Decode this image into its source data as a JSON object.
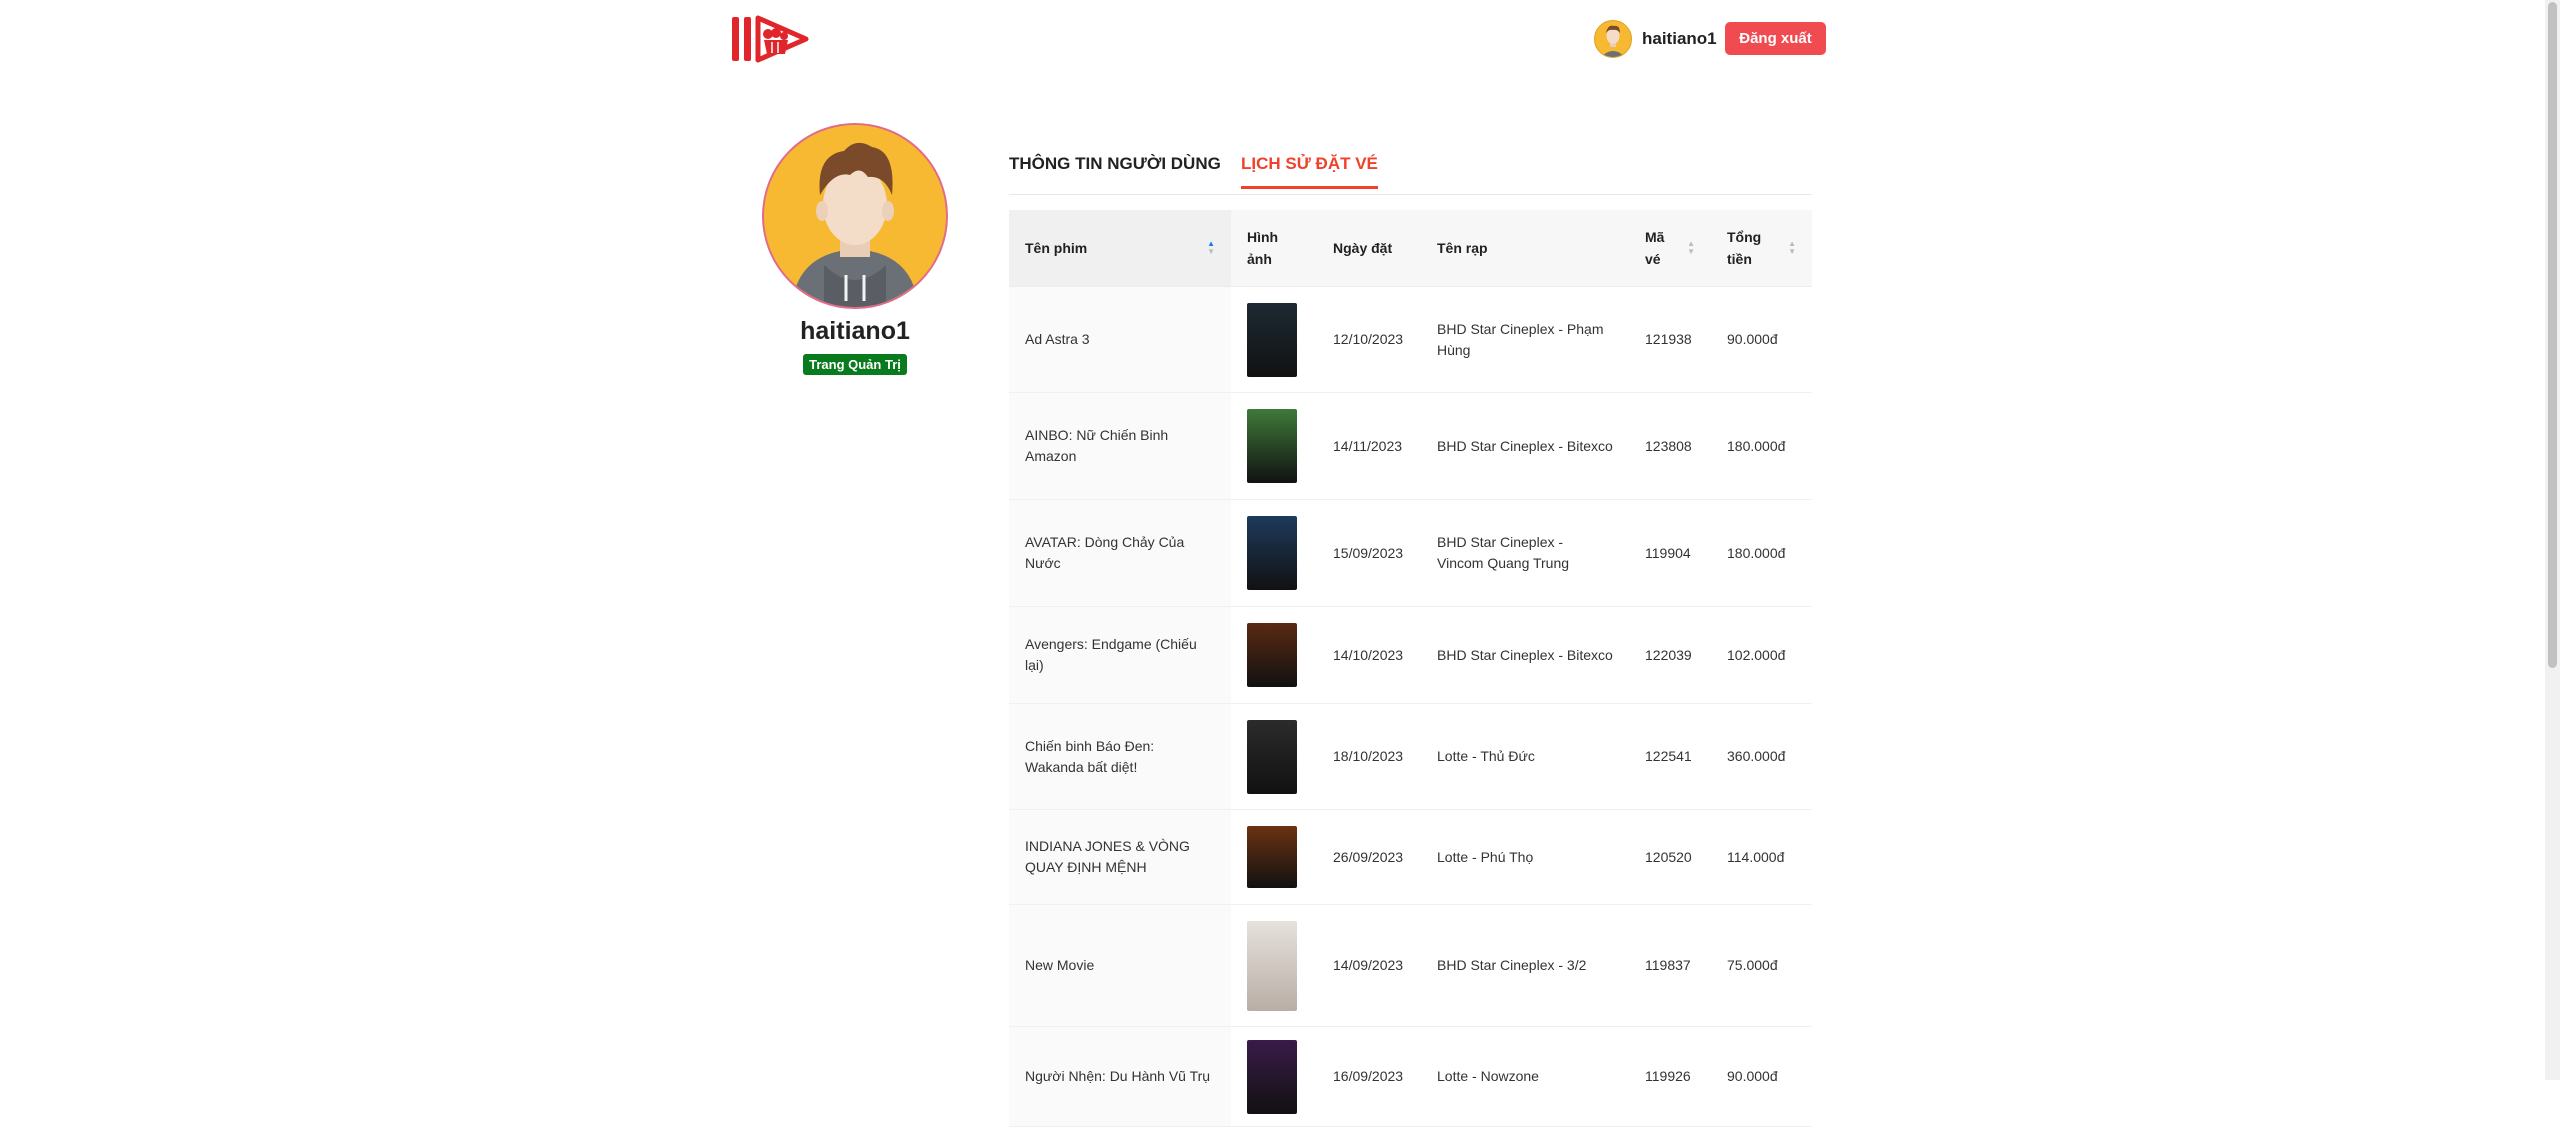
{
  "header": {
    "username": "haitiano1",
    "logout_label": "Đăng xuất"
  },
  "profile": {
    "name": "haitiano1",
    "admin_badge": "Trang Quản Trị"
  },
  "tabs": [
    {
      "label": "THÔNG TIN NGƯỜI DÙNG",
      "active": false
    },
    {
      "label": "LỊCH SỬ ĐẶT VÉ",
      "active": true
    }
  ],
  "table": {
    "columns": {
      "film": "Tên phim",
      "image": "Hình ảnh",
      "date": "Ngày đặt",
      "cinema": "Tên rạp",
      "code": "Mã vé",
      "total": "Tổng tiền"
    },
    "rows": [
      {
        "film": "Ad Astra 3",
        "date": "12/10/2023",
        "cinema": "BHD Star Cineplex - Phạm Hùng",
        "code": "121938",
        "total": "90.000đ",
        "poster_color": "#1d2a33"
      },
      {
        "film": "AINBO: Nữ Chiến Binh Amazon",
        "date": "14/11/2023",
        "cinema": "BHD Star Cineplex - Bitexco",
        "code": "123808",
        "total": "180.000đ",
        "poster_color": "#3f7a3a"
      },
      {
        "film": "AVATAR: Dòng Chảy Của Nước",
        "date": "15/09/2023",
        "cinema": "BHD Star Cineplex - Vincom Quang Trung",
        "code": "119904",
        "total": "180.000đ",
        "poster_color": "#1e3a5c"
      },
      {
        "film": "Avengers: Endgame (Chiếu lại)",
        "date": "14/10/2023",
        "cinema": "BHD Star Cineplex - Bitexco",
        "code": "122039",
        "total": "102.000đ",
        "poster_color": "#5a2a12"
      },
      {
        "film": "Chiến binh Báo Đen: Wakanda bất diệt!",
        "date": "18/10/2023",
        "cinema": "Lotte - Thủ Đức",
        "code": "122541",
        "total": "360.000đ",
        "poster_color": "#2b2b2b"
      },
      {
        "film": "INDIANA JONES & VÒNG QUAY ĐỊNH MỆNH",
        "date": "26/09/2023",
        "cinema": "Lotte - Phú Thọ",
        "code": "120520",
        "total": "114.000đ",
        "poster_color": "#6b3312"
      },
      {
        "film": "New Movie",
        "date": "14/09/2023",
        "cinema": "BHD Star Cineplex - 3/2",
        "code": "119837",
        "total": "75.000đ",
        "poster_color": "#d9d2cc"
      },
      {
        "film": "Người Nhện: Du Hành Vũ Trụ",
        "date": "16/09/2023",
        "cinema": "Lotte - Nowzone",
        "code": "119926",
        "total": "90.000đ",
        "poster_color": "#3a1b4a"
      }
    ]
  },
  "colors": {
    "accent": "#f0412b",
    "logout": "#f14b52",
    "badge": "#0a7a1e",
    "logo": "#e0262b"
  }
}
